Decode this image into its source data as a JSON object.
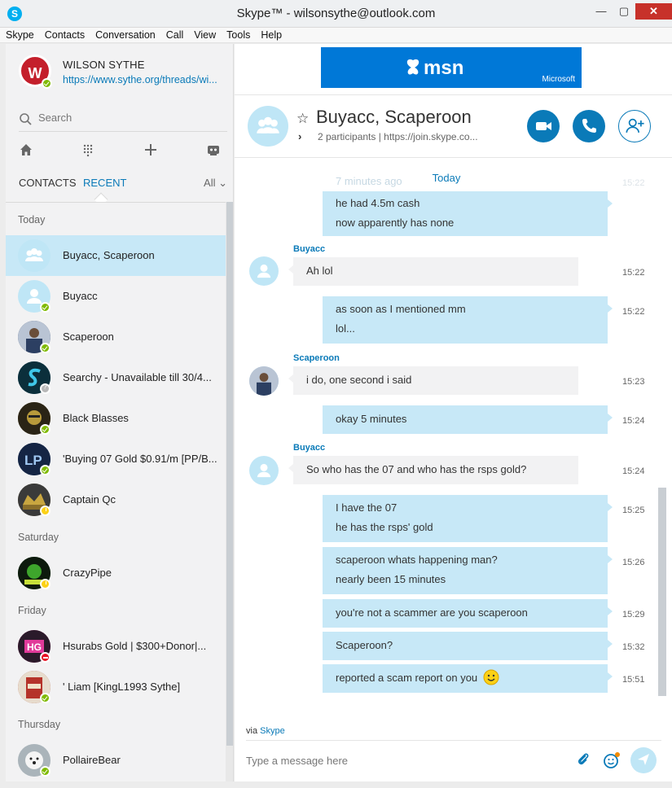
{
  "window": {
    "title": "Skype™ - wilsonsythe@outlook.com",
    "app_icon": "S",
    "min": "—",
    "max": "▢",
    "close": "✕"
  },
  "menu": [
    "Skype",
    "Contacts",
    "Conversation",
    "Call",
    "View",
    "Tools",
    "Help"
  ],
  "profile": {
    "name": "WILSON SYTHE",
    "mood": "https://www.sythe.org/threads/wi...",
    "avatar_text": "W",
    "status": "online"
  },
  "search": {
    "placeholder": "Search"
  },
  "tabs": {
    "contacts": "CONTACTS",
    "recent": "RECENT",
    "filter": "All ⌄"
  },
  "groups": [
    "Today",
    "Saturday",
    "Friday",
    "Thursday"
  ],
  "contacts": [
    {
      "name": "Buyacc, Scaperoon",
      "status": "none",
      "avatar": "group",
      "active": true
    },
    {
      "name": "Buyacc",
      "status": "online",
      "avatar": "placeholder"
    },
    {
      "name": "Scaperoon",
      "status": "online",
      "avatar": "photo",
      "color": "#2c3f62"
    },
    {
      "name": "Searchy - Unavailable till 30/4...",
      "status": "unknown",
      "avatar": "photo",
      "color": "#0f4d5e"
    },
    {
      "name": "Black Blasses",
      "status": "online",
      "avatar": "photo",
      "color": "#7a6a33"
    },
    {
      "name": "'Buying 07 Gold $0.91/m [PP/B...",
      "status": "online",
      "avatar": "photo",
      "color": "#1b3c6b"
    },
    {
      "name": "Captain Qc",
      "status": "away",
      "avatar": "photo",
      "color": "#6b5a2a"
    },
    {
      "name": "CrazyPipe",
      "status": "away",
      "avatar": "photo",
      "color": "#1f5f1a"
    },
    {
      "name": "Hsurabs Gold | $300+Donor|...",
      "status": "dnd",
      "avatar": "photo",
      "color": "#c4307a"
    },
    {
      "name": "' Liam [KingL1993 Sythe]",
      "status": "online",
      "avatar": "photo",
      "color": "#a23a2a"
    },
    {
      "name": "PollaireBear",
      "status": "online",
      "avatar": "photo",
      "color": "#d8dde0"
    }
  ],
  "ad": {
    "logo": "msn",
    "brand": "Microsoft"
  },
  "conversation": {
    "name": "Buyacc, Scaperoon",
    "subtitle": "2 participants  |  https://join.skype.co...",
    "today": "Today",
    "ghost_time": "7 minutes ago",
    "ghost_right": "15:22"
  },
  "messages": [
    {
      "dir": "out",
      "lines": [
        "he had 4.5m cash",
        "now apparently has none"
      ],
      "time": ""
    },
    {
      "dir": "in",
      "sender": "Buyacc",
      "lines": [
        "Ah lol"
      ],
      "time": "15:22"
    },
    {
      "dir": "out",
      "lines": [
        "as soon as I mentioned mm",
        "lol..."
      ],
      "time": "15:22"
    },
    {
      "dir": "in",
      "sender": "Scaperoon",
      "lines": [
        "i do, one second i said"
      ],
      "time": "15:23"
    },
    {
      "dir": "out",
      "lines": [
        "okay 5 minutes"
      ],
      "time": "15:24"
    },
    {
      "dir": "in",
      "sender": "Buyacc",
      "lines": [
        "So who has the 07 and who has the rsps gold?"
      ],
      "time": "15:24"
    },
    {
      "dir": "out",
      "lines": [
        "I have the 07",
        "he has the rsps' gold"
      ],
      "time": "15:25"
    },
    {
      "dir": "out",
      "lines": [
        "scaperoon whats happening man?",
        "nearly been 15 minutes"
      ],
      "time": "15:26"
    },
    {
      "dir": "out",
      "lines": [
        "you're not a scammer are you scaperoon"
      ],
      "time": "15:29"
    },
    {
      "dir": "out",
      "lines": [
        "Scaperoon?"
      ],
      "time": "15:32"
    },
    {
      "dir": "out",
      "lines": [
        "reported a scam report on you"
      ],
      "time": "15:51"
    }
  ],
  "composer": {
    "via_prefix": "via",
    "via_link": "Skype",
    "placeholder": "Type a message here"
  },
  "colors": {
    "accent": "#0a7ab8",
    "bubble_out": "#c7e8f7",
    "bubble_in": "#f2f2f3",
    "online": "#7fba00",
    "away": "#fcd116",
    "dnd": "#e81123"
  }
}
